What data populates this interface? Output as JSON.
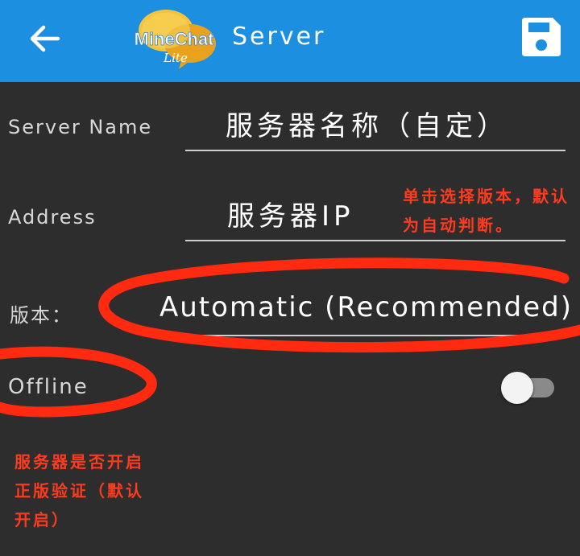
{
  "appbar": {
    "title": "Server",
    "logo_text": "MineChat",
    "logo_sub": "Lite",
    "back_icon": "arrow-back-icon",
    "save_icon": "save-icon",
    "color": "#1d8fe0"
  },
  "form": {
    "server_name_label": "Server Name",
    "server_name_value": "服务器名称（自定）",
    "address_label": "Address",
    "address_value": "服务器IP",
    "version_label": "版本：",
    "version_value": "Automatic (Recommended)",
    "offline_label": "Offline",
    "offline_enabled": false
  },
  "annotations": {
    "version_note_line1": "单击选择版本，默认",
    "version_note_line2": "为自动判断。",
    "offline_note_line1": "服务器是否开启",
    "offline_note_line2": "正版验证（默认",
    "offline_note_line3": "开启）",
    "color": "#ff3b1f"
  }
}
